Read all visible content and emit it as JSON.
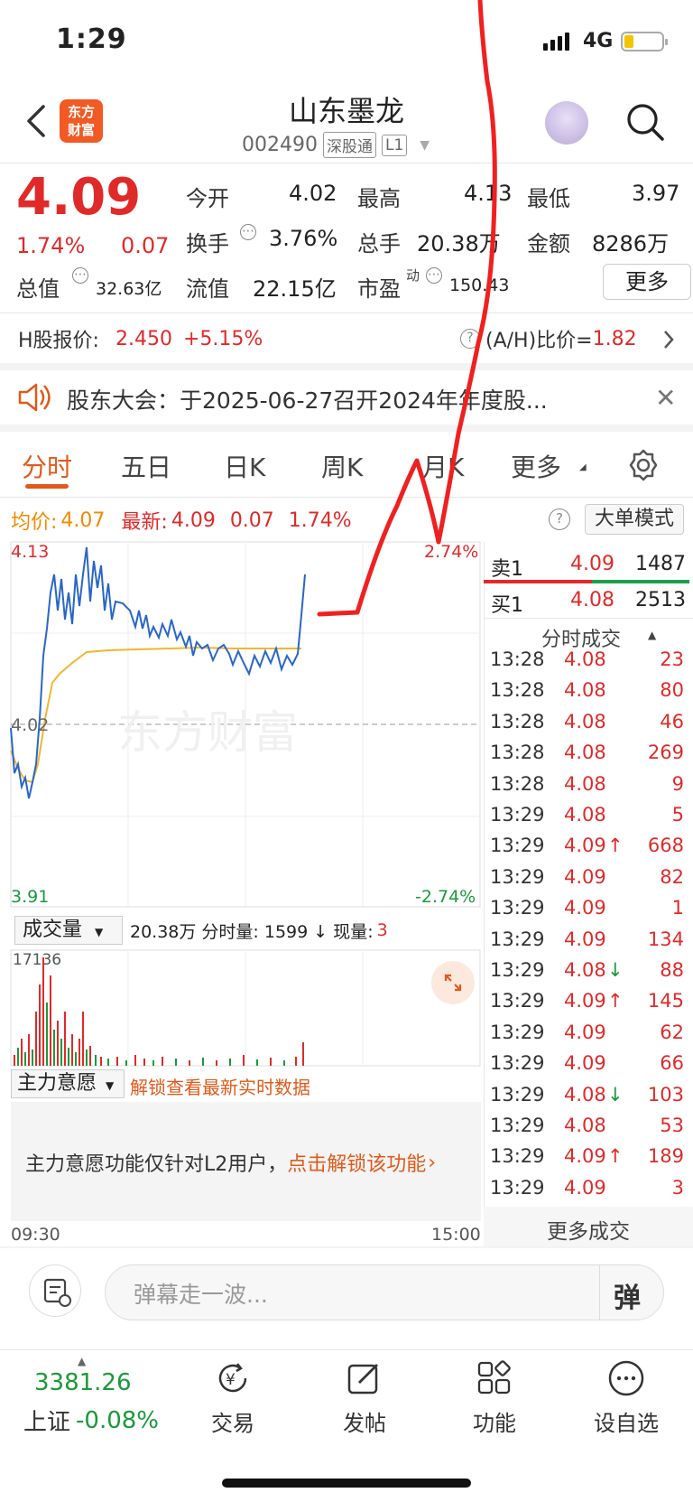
{
  "status": {
    "time": "1:29",
    "network": "4G"
  },
  "header": {
    "logo_line1": "东方",
    "logo_line2": "财富",
    "title": "山东墨龙",
    "code": "002490",
    "tag1": "深股通",
    "tag2": "L1"
  },
  "quote": {
    "price": "4.09",
    "change_pct": "1.74%",
    "change_amt": "0.07",
    "open_label": "今开",
    "open": "4.02",
    "high_label": "最高",
    "high": "4.13",
    "low_label": "最低",
    "low": "3.97",
    "turnover_label": "换手",
    "turnover": "3.76%",
    "volume_label": "总手",
    "volume": "20.38万",
    "amount_label": "金额",
    "amount": "8286万",
    "mktcap_label": "总值",
    "mktcap": "32.63亿",
    "float_label": "流值",
    "float": "22.15亿",
    "pe_label": "市盈",
    "pe_sup": "动",
    "pe": "150.43",
    "more_label": "更多"
  },
  "hshare": {
    "label": "H股报价:",
    "price": "2.450",
    "pct": "+5.15%",
    "ratio_label": "(A/H)比价=",
    "ratio": "1.82"
  },
  "notice": {
    "text": "股东大会：于2025-06-27召开2024年年度股..."
  },
  "tabs": [
    "分时",
    "五日",
    "日K",
    "周K",
    "月K",
    "更多"
  ],
  "legend": {
    "avg_label": "均价:",
    "avg": "4.07",
    "latest_label": "最新:",
    "latest": "4.09",
    "latest_chg": "0.07",
    "latest_pct": "1.74%",
    "mode_label": "大单模式"
  },
  "chart": {
    "y_high": "4.13",
    "y_mid": "4.02",
    "y_low": "3.91",
    "pct_high": "2.74%",
    "pct_low": "-2.74%",
    "x_start": "09:30",
    "x_end": "15:00",
    "watermark": "东方财富"
  },
  "volume": {
    "selector": "成交量",
    "summary": "20.38万 分时量: 1599 ↓ 现量:",
    "current": "3",
    "max": "17136"
  },
  "main_force": {
    "selector": "主力意愿",
    "unlock_hint": "解锁查看最新实时数据",
    "text": "主力意愿功能仅针对L2用户，",
    "link": "点击解锁该功能"
  },
  "orderbook": {
    "sell_label": "卖1",
    "sell_price": "4.09",
    "sell_qty": "1487",
    "buy_label": "买1",
    "buy_price": "4.08",
    "buy_qty": "2513"
  },
  "trades_title": "分时成交",
  "trades": [
    {
      "t": "13:28",
      "p": "4.08",
      "q": "23",
      "dir": ""
    },
    {
      "t": "13:28",
      "p": "4.08",
      "q": "80",
      "dir": ""
    },
    {
      "t": "13:28",
      "p": "4.08",
      "q": "46",
      "dir": ""
    },
    {
      "t": "13:28",
      "p": "4.08",
      "q": "269",
      "dir": ""
    },
    {
      "t": "13:28",
      "p": "4.08",
      "q": "9",
      "dir": ""
    },
    {
      "t": "13:29",
      "p": "4.08",
      "q": "5",
      "dir": ""
    },
    {
      "t": "13:29",
      "p": "4.09",
      "q": "668",
      "dir": "↑"
    },
    {
      "t": "13:29",
      "p": "4.09",
      "q": "82",
      "dir": ""
    },
    {
      "t": "13:29",
      "p": "4.09",
      "q": "1",
      "dir": ""
    },
    {
      "t": "13:29",
      "p": "4.09",
      "q": "134",
      "dir": ""
    },
    {
      "t": "13:29",
      "p": "4.08",
      "q": "88",
      "dir": "↓"
    },
    {
      "t": "13:29",
      "p": "4.09",
      "q": "145",
      "dir": "↑"
    },
    {
      "t": "13:29",
      "p": "4.09",
      "q": "62",
      "dir": ""
    },
    {
      "t": "13:29",
      "p": "4.09",
      "q": "66",
      "dir": ""
    },
    {
      "t": "13:29",
      "p": "4.08",
      "q": "103",
      "dir": "↓"
    },
    {
      "t": "13:29",
      "p": "4.08",
      "q": "53",
      "dir": ""
    },
    {
      "t": "13:29",
      "p": "4.09",
      "q": "189",
      "dir": "↑"
    },
    {
      "t": "13:29",
      "p": "4.09",
      "q": "3",
      "dir": ""
    }
  ],
  "more_trades": "更多成交",
  "comment": {
    "placeholder": "弹幕走一波...",
    "button": "弹"
  },
  "index": {
    "value": "3381.26",
    "name": "上证",
    "pct": "-0.08%"
  },
  "tabbar": [
    "交易",
    "发帖",
    "功能",
    "设自选"
  ],
  "colors": {
    "up": "#e02a2a",
    "down": "#1a9a3a",
    "accent": "#e05a1a",
    "price_line": "#2a66c8",
    "avg_line": "#f2b630"
  }
}
